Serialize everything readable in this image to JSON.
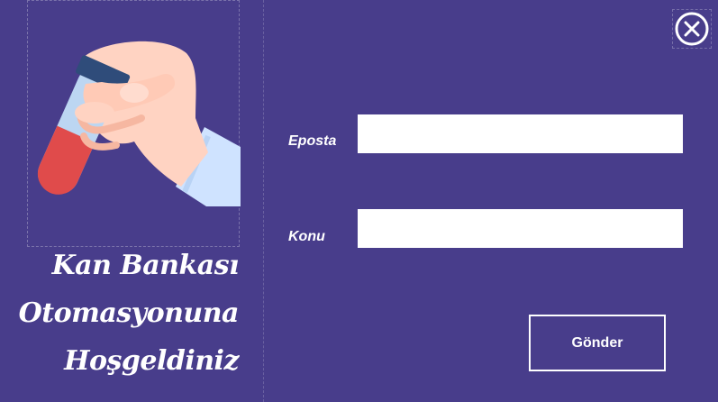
{
  "illustration": {
    "icon": "blood-test-tube-hand-icon"
  },
  "welcome": {
    "line1": "Kan Bankası",
    "line2": "Otomasyonuna",
    "line3": "Hoşgeldiniz"
  },
  "form": {
    "email_label": "Eposta",
    "email_value": "",
    "subject_label": "Konu",
    "subject_value": "",
    "send_label": "Gönder"
  },
  "close": {
    "icon": "close-icon"
  },
  "colors": {
    "background": "#483d8b",
    "text": "#ffffff",
    "input": "#ffffff",
    "blood": "#e04b4b"
  }
}
